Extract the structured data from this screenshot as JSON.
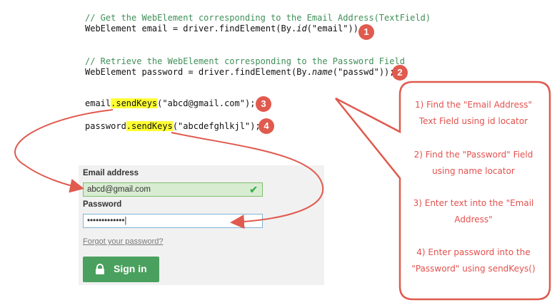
{
  "code": {
    "comment1": "// Get the WebElement corresponding to the Email Address(TextField)",
    "line1_pre": "WebElement email = driver.findElement(By.",
    "line1_method": "id",
    "line1_post": "(\"email\"));",
    "comment2": "// Retrieve the WebElement corresponding to the Password Field",
    "line2_pre": "WebElement password = driver.findElement(By.",
    "line2_method": "name",
    "line2_post": "(\"passwd\"));",
    "line3_obj": "email",
    "line3_dot": ".",
    "line3_method": "sendKeys",
    "line3_rest": "(\"abcd@gmail.com\");",
    "line4_obj": "password",
    "line4_dot": ".",
    "line4_method": "sendKeys",
    "line4_rest": "(\"abcdefghlkjl\");"
  },
  "badges": [
    "1",
    "2",
    "3",
    "4"
  ],
  "login_form": {
    "email_label": "Email address",
    "email_value": "abcd@gmail.com",
    "password_label": "Password",
    "password_value": "•••••••••••••|",
    "forgot_link": "Forgot your password?",
    "signin_label": "Sign in",
    "check_icon": "check-icon",
    "lock_icon": "lock-icon"
  },
  "callout": {
    "step1_line1": "1) Find the \"Email Address\"",
    "step1_line2": "Text Field using id locator",
    "step2_line1": "2) Find the \"Password\" Field",
    "step2_line2": "using name locator",
    "step3_line1": "3) Enter text into the \"Email",
    "step3_line2": "Address\"",
    "step4_line1": "4) Enter password into the",
    "step4_line2": "\"Password\" using sendKeys()"
  },
  "colors": {
    "accent_red": "#e05a4e",
    "highlight": "#ffff33",
    "comment_green": "#3f8f58",
    "signin_green": "#4aa05e"
  }
}
